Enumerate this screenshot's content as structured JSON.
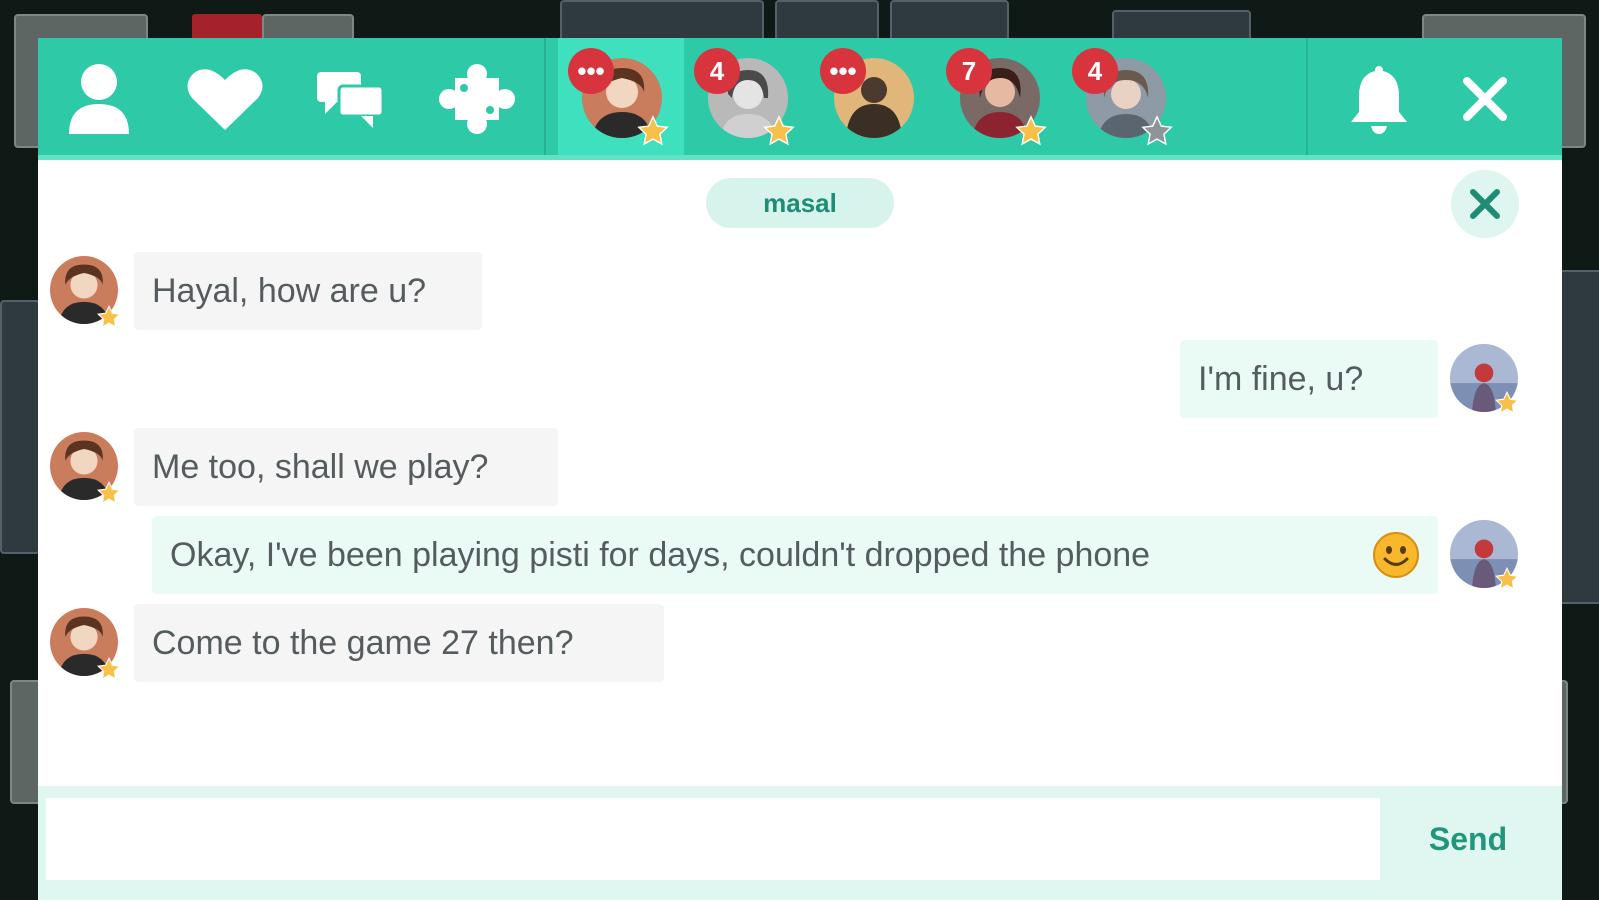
{
  "topbar": {
    "icons": [
      "user-icon",
      "heart-icon",
      "chat-bubbles-icon",
      "puzzle-icon",
      "bell-icon",
      "close-icon"
    ],
    "friends": [
      {
        "name": "friend-1",
        "badge": "•••",
        "star": "gold",
        "active": true
      },
      {
        "name": "friend-2",
        "badge": "4",
        "star": "gold",
        "active": false
      },
      {
        "name": "friend-3",
        "badge": "•••",
        "star": "none",
        "active": false
      },
      {
        "name": "friend-4",
        "badge": "7",
        "star": "gold",
        "active": false
      },
      {
        "name": "friend-5",
        "badge": "4",
        "star": "gray",
        "active": false
      }
    ]
  },
  "conversation": {
    "title": "masal",
    "messages": [
      {
        "side": "in",
        "text": "Hayal, how are u?"
      },
      {
        "side": "out",
        "text": "I'm fine, u?"
      },
      {
        "side": "in",
        "text": "Me too, shall we play?"
      },
      {
        "side": "out",
        "text": "Okay, I've been playing pisti for days, couldn't dropped the phone",
        "emoji": "smiley-emoji"
      },
      {
        "side": "in",
        "text": "Come to the game 27 then?"
      }
    ]
  },
  "composer": {
    "value": "",
    "placeholder": "",
    "send_label": "Send"
  },
  "colors": {
    "accent": "#2ec9a6",
    "accent_active": "#3ee0bd",
    "badge": "#d7343e",
    "star_gold": "#f6c04a",
    "send_text": "#20967c"
  }
}
